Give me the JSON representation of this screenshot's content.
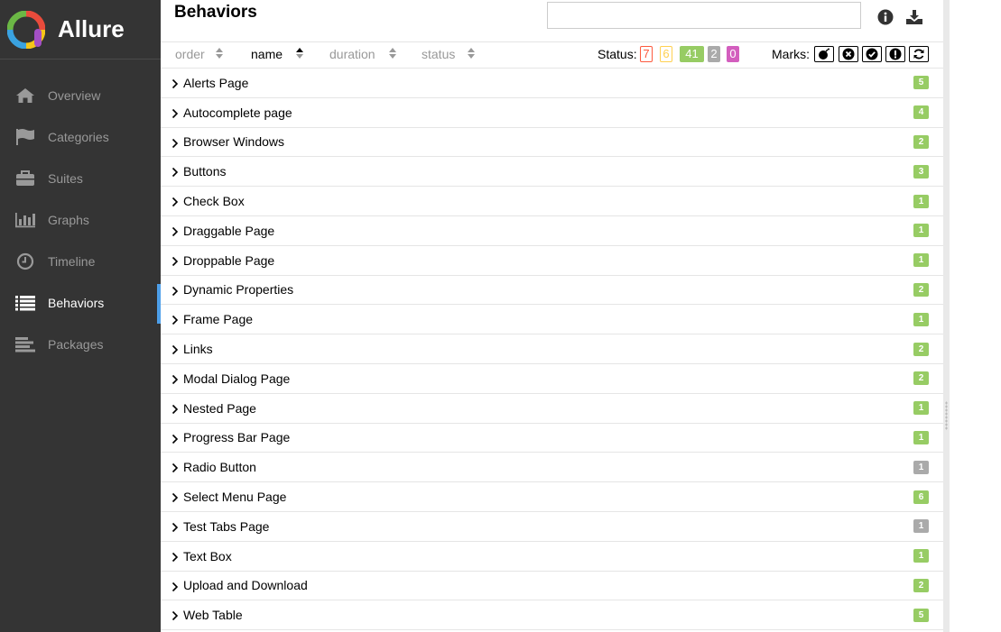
{
  "app": {
    "name": "Allure",
    "accent": "#4d9fe9",
    "sidebar_bg": "#343434"
  },
  "sidebar": {
    "items": [
      {
        "label": "Overview",
        "icon": "home-icon"
      },
      {
        "label": "Categories",
        "icon": "flag-icon"
      },
      {
        "label": "Suites",
        "icon": "briefcase-icon"
      },
      {
        "label": "Graphs",
        "icon": "bar-chart-icon"
      },
      {
        "label": "Timeline",
        "icon": "clock-icon"
      },
      {
        "label": "Behaviors",
        "icon": "list-icon",
        "active": true
      },
      {
        "label": "Packages",
        "icon": "align-left-icon"
      }
    ]
  },
  "header": {
    "title": "Behaviors",
    "search_value": "",
    "info_icon": "info-icon",
    "download_icon": "download-icon"
  },
  "toolbar": {
    "sort": {
      "order": "order",
      "name": "name",
      "duration": "duration",
      "status": "status",
      "active": "name"
    },
    "status_label": "Status:",
    "status_counts": {
      "failed": "7",
      "broken": "6",
      "passed": "41",
      "skipped": "2",
      "unknown": "0"
    },
    "status_colors": {
      "failed": "#fd5a3e",
      "broken": "#ffd050",
      "passed": "#97cc64",
      "skipped": "#aaaaaa",
      "unknown": "#d35ebe"
    },
    "marks_label": "Marks:",
    "marks": [
      "flaky-icon",
      "new-failed-icon",
      "new-passed-icon",
      "new-broken-icon",
      "retries-icon"
    ]
  },
  "rows": [
    {
      "name": "Alerts Page",
      "count": "5",
      "status": "passed"
    },
    {
      "name": "Autocomplete page",
      "count": "4",
      "status": "passed"
    },
    {
      "name": "Browser Windows",
      "count": "2",
      "status": "passed"
    },
    {
      "name": "Buttons",
      "count": "3",
      "status": "passed"
    },
    {
      "name": "Check Box",
      "count": "1",
      "status": "passed"
    },
    {
      "name": "Draggable Page",
      "count": "1",
      "status": "passed"
    },
    {
      "name": "Droppable Page",
      "count": "1",
      "status": "passed"
    },
    {
      "name": "Dynamic Properties",
      "count": "2",
      "status": "passed"
    },
    {
      "name": "Frame Page",
      "count": "1",
      "status": "passed"
    },
    {
      "name": "Links",
      "count": "2",
      "status": "passed"
    },
    {
      "name": "Modal Dialog Page",
      "count": "2",
      "status": "passed"
    },
    {
      "name": "Nested Page",
      "count": "1",
      "status": "passed"
    },
    {
      "name": "Progress Bar Page",
      "count": "1",
      "status": "passed"
    },
    {
      "name": "Radio Button",
      "count": "1",
      "status": "unknown"
    },
    {
      "name": "Select Menu Page",
      "count": "6",
      "status": "passed"
    },
    {
      "name": "Test Tabs Page",
      "count": "1",
      "status": "unknown"
    },
    {
      "name": "Text Box",
      "count": "1",
      "status": "passed"
    },
    {
      "name": "Upload and Download",
      "count": "2",
      "status": "passed"
    },
    {
      "name": "Web Table",
      "count": "5",
      "status": "passed"
    }
  ]
}
